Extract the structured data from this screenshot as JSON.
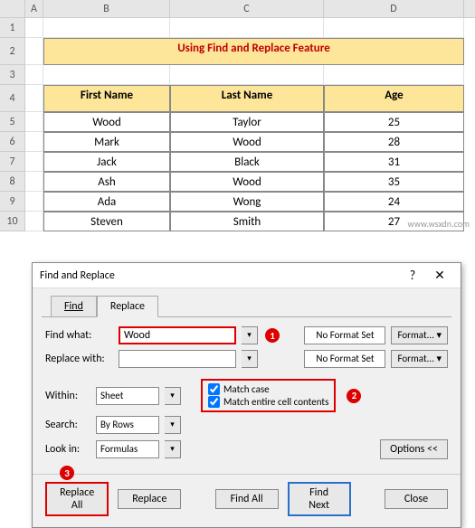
{
  "columns": [
    "A",
    "B",
    "C",
    "D"
  ],
  "rows": [
    "1",
    "2",
    "3",
    "4",
    "5",
    "6",
    "7",
    "8",
    "9",
    "10"
  ],
  "title": "Using Find and Replace Feature",
  "headers": {
    "b": "First Name",
    "c": "Last Name",
    "d": "Age"
  },
  "data": [
    {
      "b": "Wood",
      "c": "Taylor",
      "d": "25"
    },
    {
      "b": "Mark",
      "c": "Wood",
      "d": "28"
    },
    {
      "b": "Jack",
      "c": "Black",
      "d": "31"
    },
    {
      "b": "Ash",
      "c": "Wood",
      "d": "35"
    },
    {
      "b": "Ada",
      "c": "Wong",
      "d": "24"
    },
    {
      "b": "Steven",
      "c": "Smith",
      "d": "27"
    }
  ],
  "dialog": {
    "title": "Find and Replace",
    "help": "?",
    "close": "✕",
    "tabs": {
      "find": "Find",
      "replace": "Replace"
    },
    "find_label": "Find what:",
    "find_value": "Wood",
    "replace_label": "Replace with:",
    "replace_value": "",
    "no_format": "No Format Set",
    "format_btn": "Format...",
    "within_label": "Within:",
    "within_value": "Sheet",
    "search_label": "Search:",
    "search_value": "By Rows",
    "lookin_label": "Look in:",
    "lookin_value": "Formulas",
    "match_case": "Match case",
    "match_entire": "Match entire cell contents",
    "options_btn": "Options <<",
    "replace_all": "Replace All",
    "replace_btn": "Replace",
    "find_all": "Find All",
    "find_next": "Find Next",
    "close_btn": "Close"
  },
  "callouts": {
    "c1": "1",
    "c2": "2",
    "c3": "3"
  },
  "watermark": "www.wsxdn.com"
}
